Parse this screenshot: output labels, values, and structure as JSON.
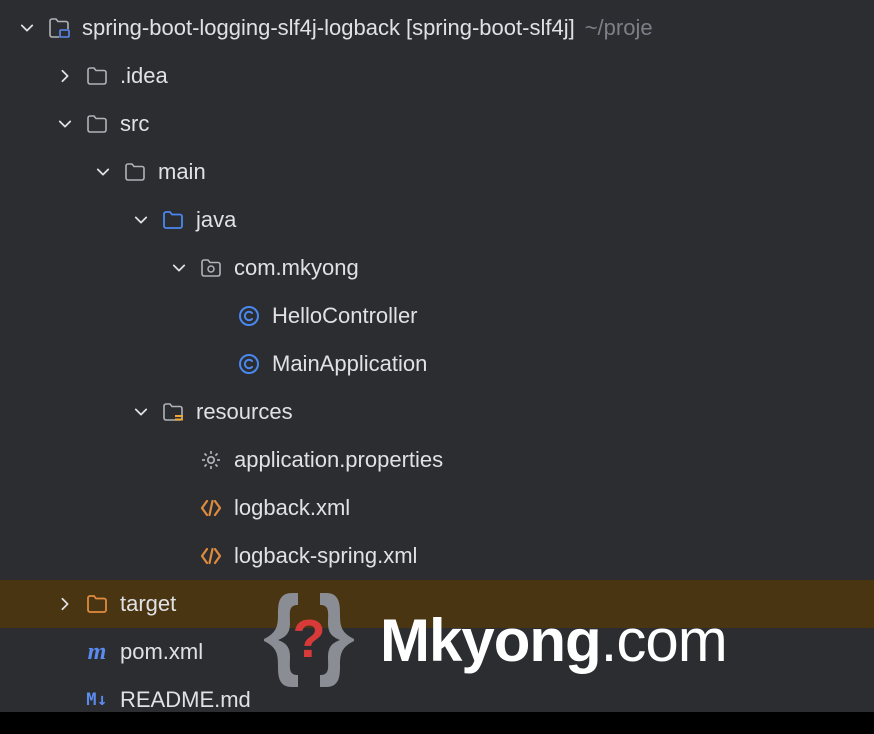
{
  "tree": {
    "root": {
      "name": "spring-boot-logging-slf4j-logback",
      "bracket": "[spring-boot-slf4j]",
      "path": "~/proje"
    },
    "idea": ".idea",
    "src": "src",
    "main": "main",
    "java": "java",
    "package": "com.mkyong",
    "class1": "HelloController",
    "class2": "MainApplication",
    "resources": "resources",
    "appprops": "application.properties",
    "logback1": "logback.xml",
    "logback2": "logback-spring.xml",
    "target": "target",
    "pom": "pom.xml",
    "readme": "README.md"
  },
  "icons": {
    "md_badge": "M↓",
    "m_badge": "m"
  },
  "watermark": {
    "name": "Mkyong",
    "suffix": ".com"
  }
}
